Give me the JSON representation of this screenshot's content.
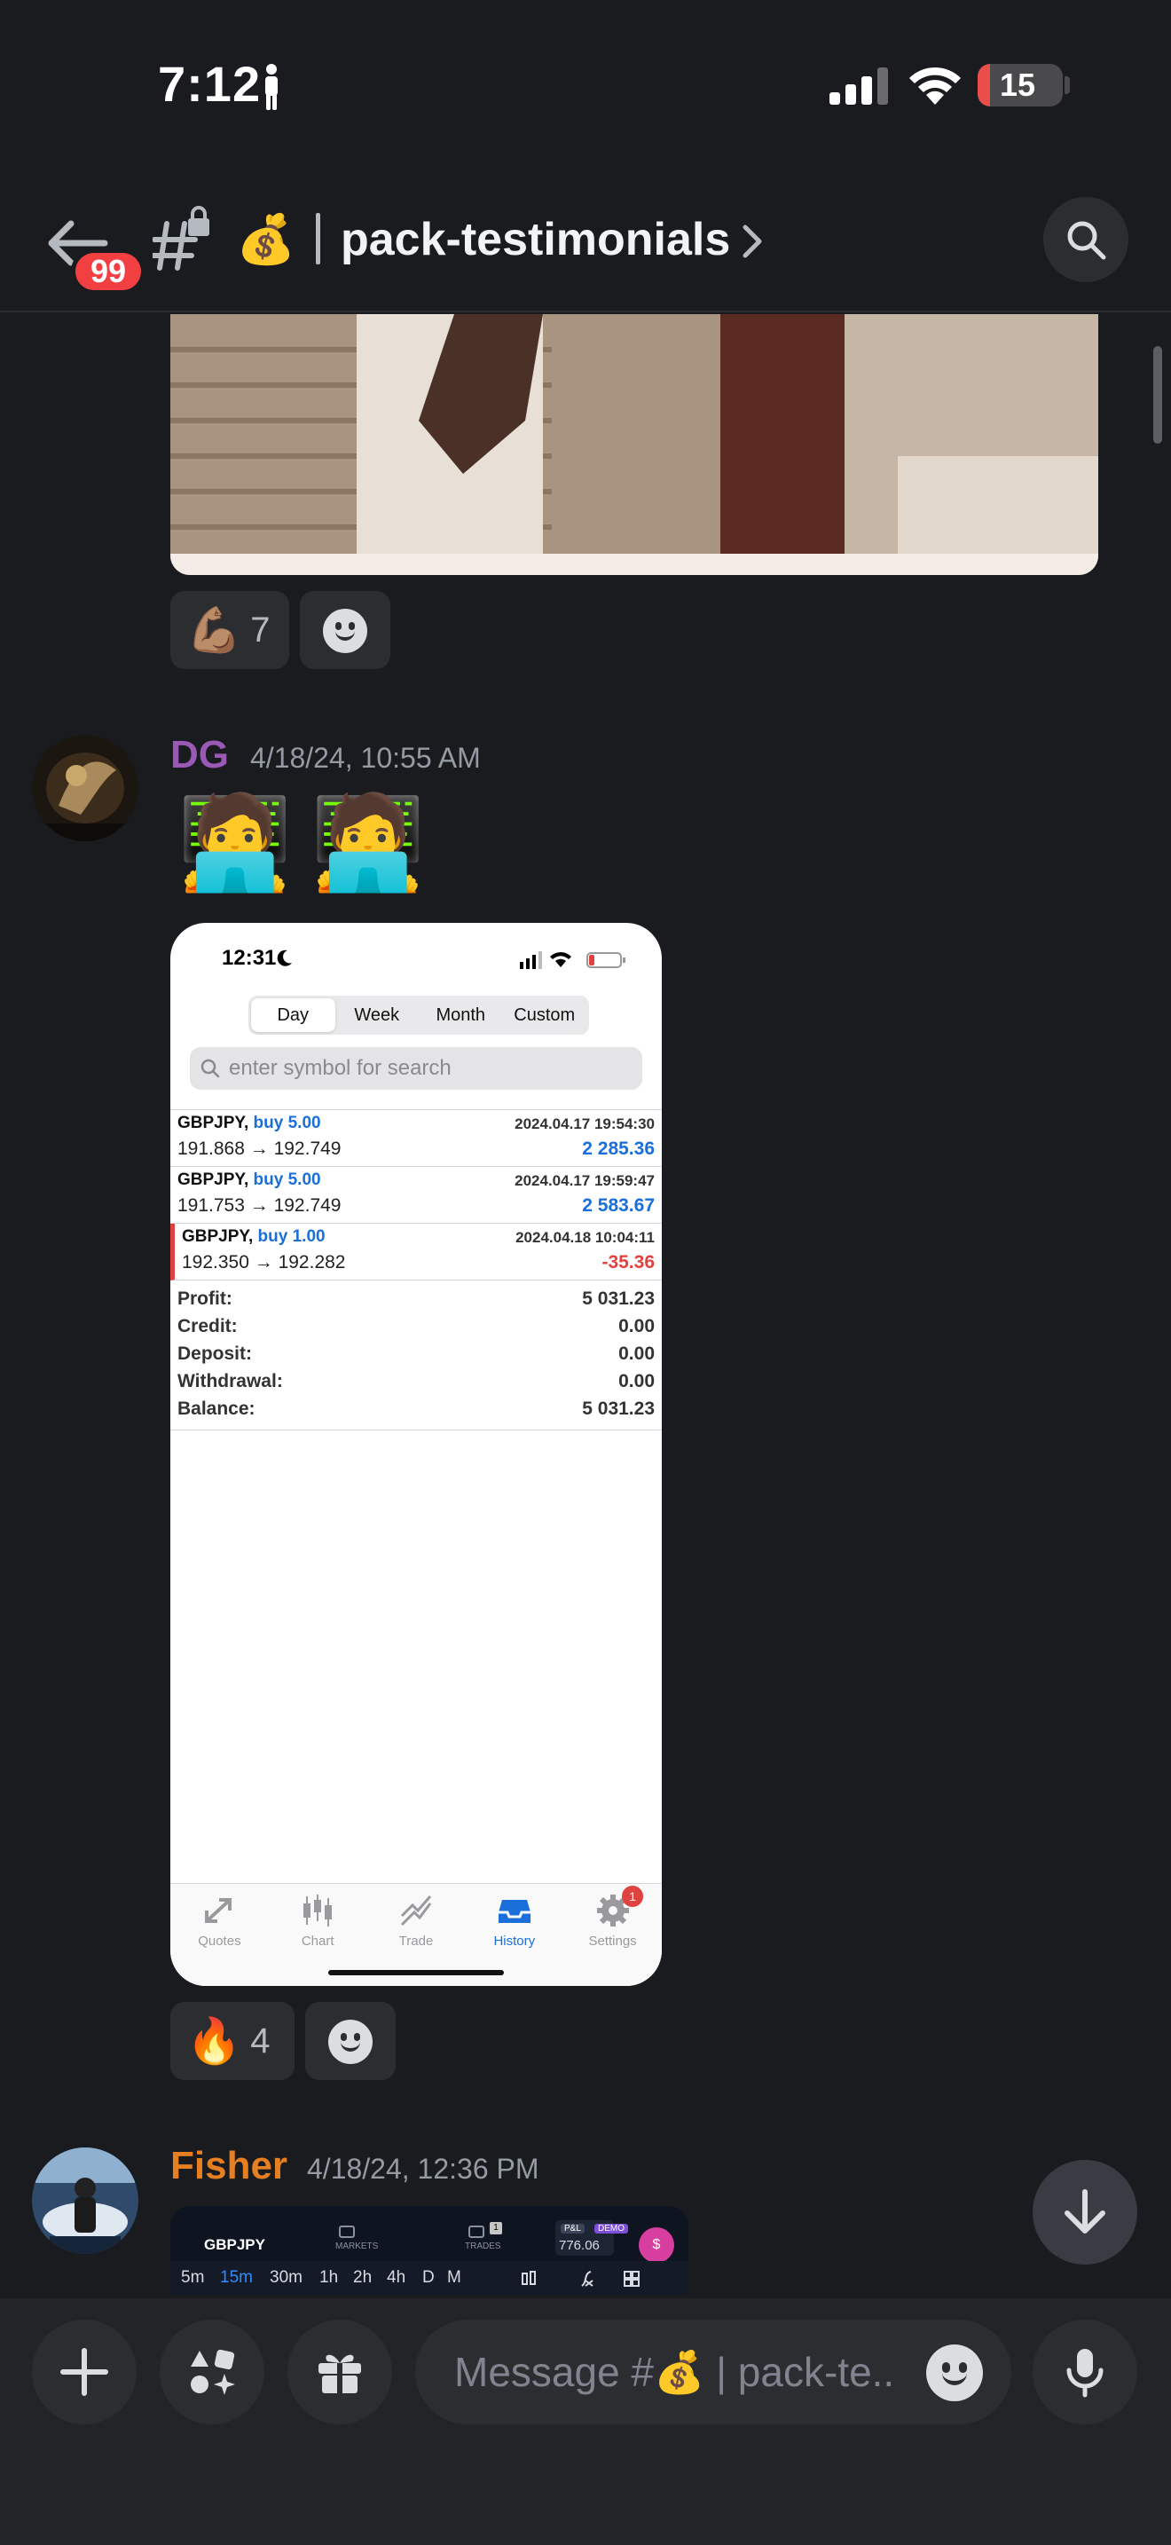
{
  "status_bar": {
    "time": "7:12",
    "battery": "15",
    "battery_level": 0.15
  },
  "header": {
    "back_badge": "99",
    "channel_emoji": "💰",
    "channel_name": "pack-testimonials"
  },
  "messages": [
    {
      "reactions": [
        {
          "emoji": "💪🏽",
          "count": "7"
        }
      ]
    },
    {
      "author": "DG",
      "author_color": "#9b59b6",
      "timestamp": "4/18/24, 10:55 AM",
      "emojis": [
        "🧑‍💻",
        "🧑‍💻"
      ],
      "screenshot": {
        "time": "12:31",
        "segments": [
          "Day",
          "Week",
          "Month",
          "Custom"
        ],
        "active_segment": "Day",
        "search_placeholder": "enter symbol for search",
        "trades": [
          {
            "symbol": "GBPJPY,",
            "side": "buy 5.00",
            "date": "2024.04.17 19:54:30",
            "prices": "191.868 → 192.749",
            "pl": "2 285.36",
            "negative": false
          },
          {
            "symbol": "GBPJPY,",
            "side": "buy 5.00",
            "date": "2024.04.17 19:59:47",
            "prices": "191.753 → 192.749",
            "pl": "2 583.67",
            "negative": false
          },
          {
            "symbol": "GBPJPY,",
            "side": "buy 1.00",
            "date": "2024.04.18 10:04:11",
            "prices": "192.350 → 192.282",
            "pl": "-35.36",
            "negative": true
          }
        ],
        "summary": [
          {
            "label": "Profit:",
            "value": "5 031.23"
          },
          {
            "label": "Credit:",
            "value": "0.00"
          },
          {
            "label": "Deposit:",
            "value": "0.00"
          },
          {
            "label": "Withdrawal:",
            "value": "0.00"
          },
          {
            "label": "Balance:",
            "value": "5 031.23"
          }
        ],
        "tabs": [
          {
            "label": "Quotes",
            "icon": "quotes-icon"
          },
          {
            "label": "Chart",
            "icon": "chart-icon"
          },
          {
            "label": "Trade",
            "icon": "trade-icon"
          },
          {
            "label": "History",
            "icon": "history-icon",
            "active": true
          },
          {
            "label": "Settings",
            "icon": "settings-icon",
            "badge": "1"
          }
        ]
      },
      "reactions": [
        {
          "emoji": "🔥",
          "count": "4"
        }
      ]
    },
    {
      "author": "Fisher",
      "author_color": "#e67e22",
      "timestamp": "4/18/24, 12:36 PM",
      "embed": {
        "symbol": "GBPJPY",
        "tabs": [
          "MARKETS",
          "TRADES"
        ],
        "trades_badge": "1",
        "pl_tag": "P&L",
        "demo_tag": "DEMO",
        "pl_value": "776.06",
        "dollar": "$",
        "timeframes": [
          "5m",
          "15m",
          "30m",
          "1h",
          "2h",
          "4h",
          "D",
          "M"
        ],
        "active_timeframe": "15m"
      }
    }
  ],
  "composer": {
    "placeholder": "Message #💰 | pack-te.."
  }
}
